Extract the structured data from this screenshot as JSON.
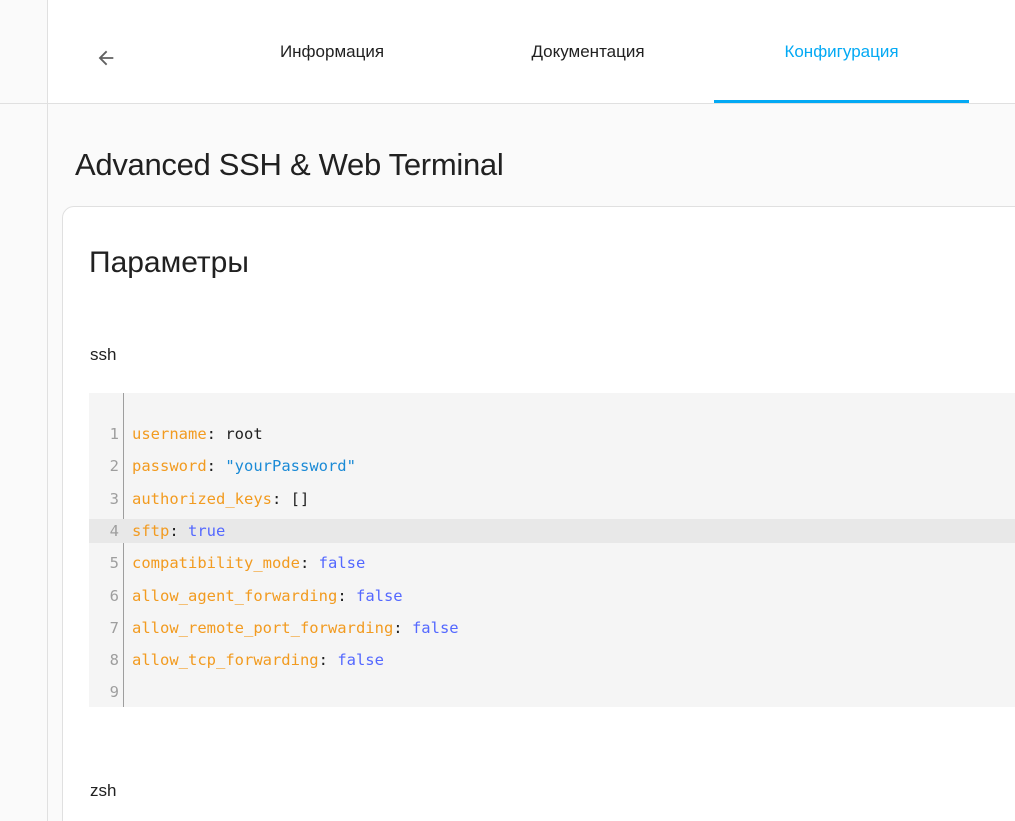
{
  "header": {
    "back_icon": "arrow-left-icon",
    "tabs": [
      {
        "label": "Информация",
        "active": false
      },
      {
        "label": "Документация",
        "active": false
      },
      {
        "label": "Конфигурация",
        "active": true
      }
    ],
    "accent_color": "#03a9f4"
  },
  "app": {
    "title": "Advanced SSH & Web Terminal"
  },
  "card": {
    "title": "Параметры",
    "sections": [
      {
        "label": "ssh",
        "lines": [
          {
            "num": "1",
            "key": "username",
            "sep": ": ",
            "value": "root",
            "value_kind": "plain"
          },
          {
            "num": "2",
            "key": "password",
            "sep": ": ",
            "value": "\"yourPassword\"",
            "value_kind": "string"
          },
          {
            "num": "3",
            "key": "authorized_keys",
            "sep": ": ",
            "value": "[]",
            "value_kind": "plain"
          },
          {
            "num": "4",
            "key": "sftp",
            "sep": ": ",
            "value": "true",
            "value_kind": "bool"
          },
          {
            "num": "5",
            "key": "compatibility_mode",
            "sep": ": ",
            "value": "false",
            "value_kind": "bool"
          },
          {
            "num": "6",
            "key": "allow_agent_forwarding",
            "sep": ": ",
            "value": "false",
            "value_kind": "bool"
          },
          {
            "num": "7",
            "key": "allow_remote_port_forwarding",
            "sep": ": ",
            "value": "false",
            "value_kind": "bool"
          },
          {
            "num": "8",
            "key": "allow_tcp_forwarding",
            "sep": ": ",
            "value": "false",
            "value_kind": "bool"
          },
          {
            "num": "9",
            "key": "",
            "sep": "",
            "value": "",
            "value_kind": "plain"
          }
        ],
        "active_line": "4"
      },
      {
        "label": "zsh"
      }
    ]
  }
}
